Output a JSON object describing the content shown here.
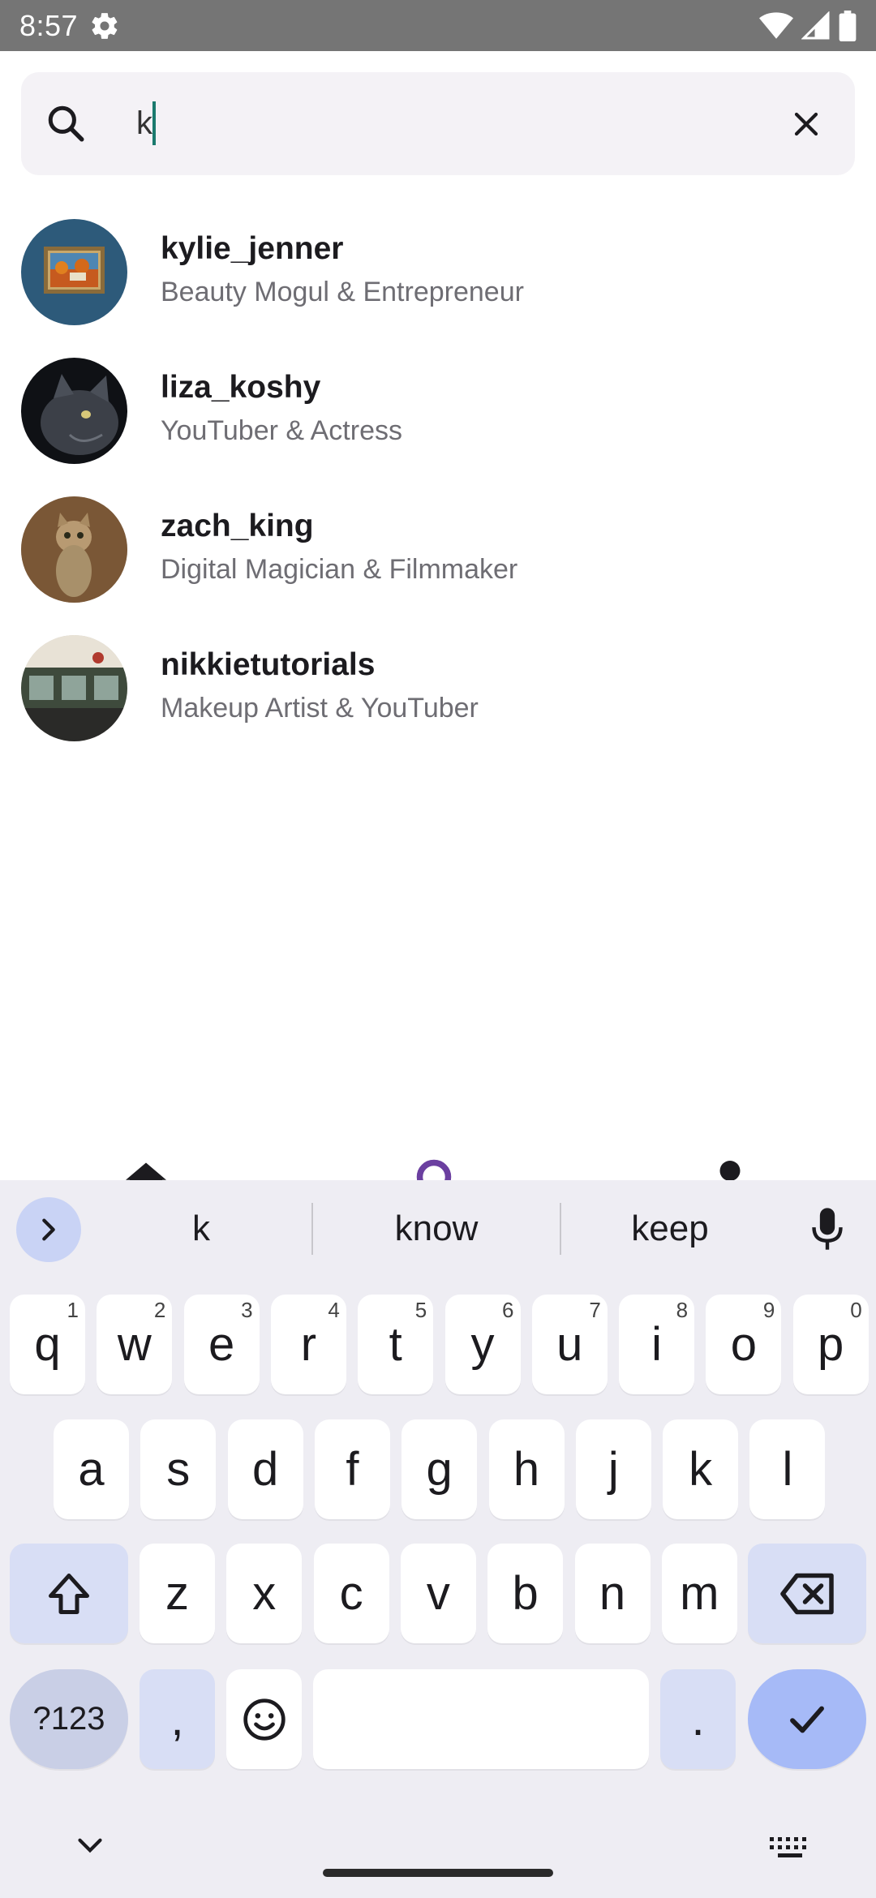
{
  "status_bar": {
    "time": "8:57",
    "icons": [
      "gear-icon",
      "wifi-icon",
      "signal-icon",
      "battery-icon"
    ]
  },
  "search": {
    "value": "k",
    "icon": "search-icon",
    "clear_icon": "close-icon"
  },
  "results": [
    {
      "name": "kylie_jenner",
      "description": "Beauty Mogul & Entrepreneur",
      "avatar": "framed-painting-avatar"
    },
    {
      "name": "liza_koshy",
      "description": "YouTuber & Actress",
      "avatar": "black-cat-avatar"
    },
    {
      "name": "zach_king",
      "description": "Digital Magician & Filmmaker",
      "avatar": "standing-cat-avatar"
    },
    {
      "name": "nikkietutorials",
      "description": "Makeup Artist & YouTuber",
      "avatar": "train-station-avatar"
    }
  ],
  "bottom_nav": {
    "items": [
      {
        "name": "home",
        "icon": "home-icon",
        "active": false
      },
      {
        "name": "search",
        "icon": "search-icon",
        "active": true
      },
      {
        "name": "profile",
        "icon": "person-icon",
        "active": false
      }
    ],
    "active_color": "#6b3fa0"
  },
  "keyboard": {
    "suggestions": [
      "k",
      "know",
      "keep"
    ],
    "row1": [
      {
        "key": "q",
        "hint": "1"
      },
      {
        "key": "w",
        "hint": "2"
      },
      {
        "key": "e",
        "hint": "3"
      },
      {
        "key": "r",
        "hint": "4"
      },
      {
        "key": "t",
        "hint": "5"
      },
      {
        "key": "y",
        "hint": "6"
      },
      {
        "key": "u",
        "hint": "7"
      },
      {
        "key": "i",
        "hint": "8"
      },
      {
        "key": "o",
        "hint": "9"
      },
      {
        "key": "p",
        "hint": "0"
      }
    ],
    "row2": [
      "a",
      "s",
      "d",
      "f",
      "g",
      "h",
      "j",
      "k",
      "l"
    ],
    "row3": [
      "z",
      "x",
      "c",
      "v",
      "b",
      "n",
      "m"
    ],
    "symbols_label": "?123",
    "comma": ",",
    "period": "."
  }
}
